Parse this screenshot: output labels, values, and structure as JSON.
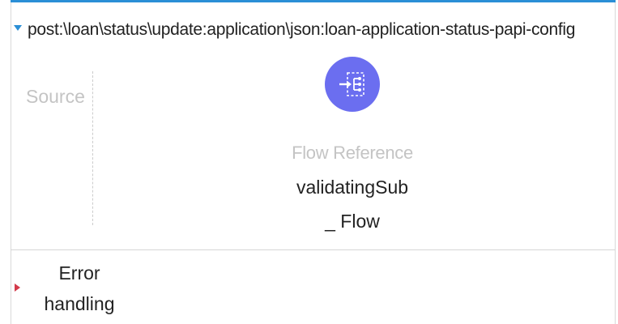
{
  "flow": {
    "name": "post:\\loan\\status\\update:application\\json:loan-application-status-papi-config",
    "accent_color": "#2b8fd6"
  },
  "source": {
    "label": "Source"
  },
  "component": {
    "type": "Flow Reference",
    "name": "validatingSub_ Flow",
    "icon": "flow-reference-icon",
    "icon_color": "#6b6ef0"
  },
  "error_handling": {
    "label": "Error handling",
    "caret_color": "#d33a4a"
  }
}
